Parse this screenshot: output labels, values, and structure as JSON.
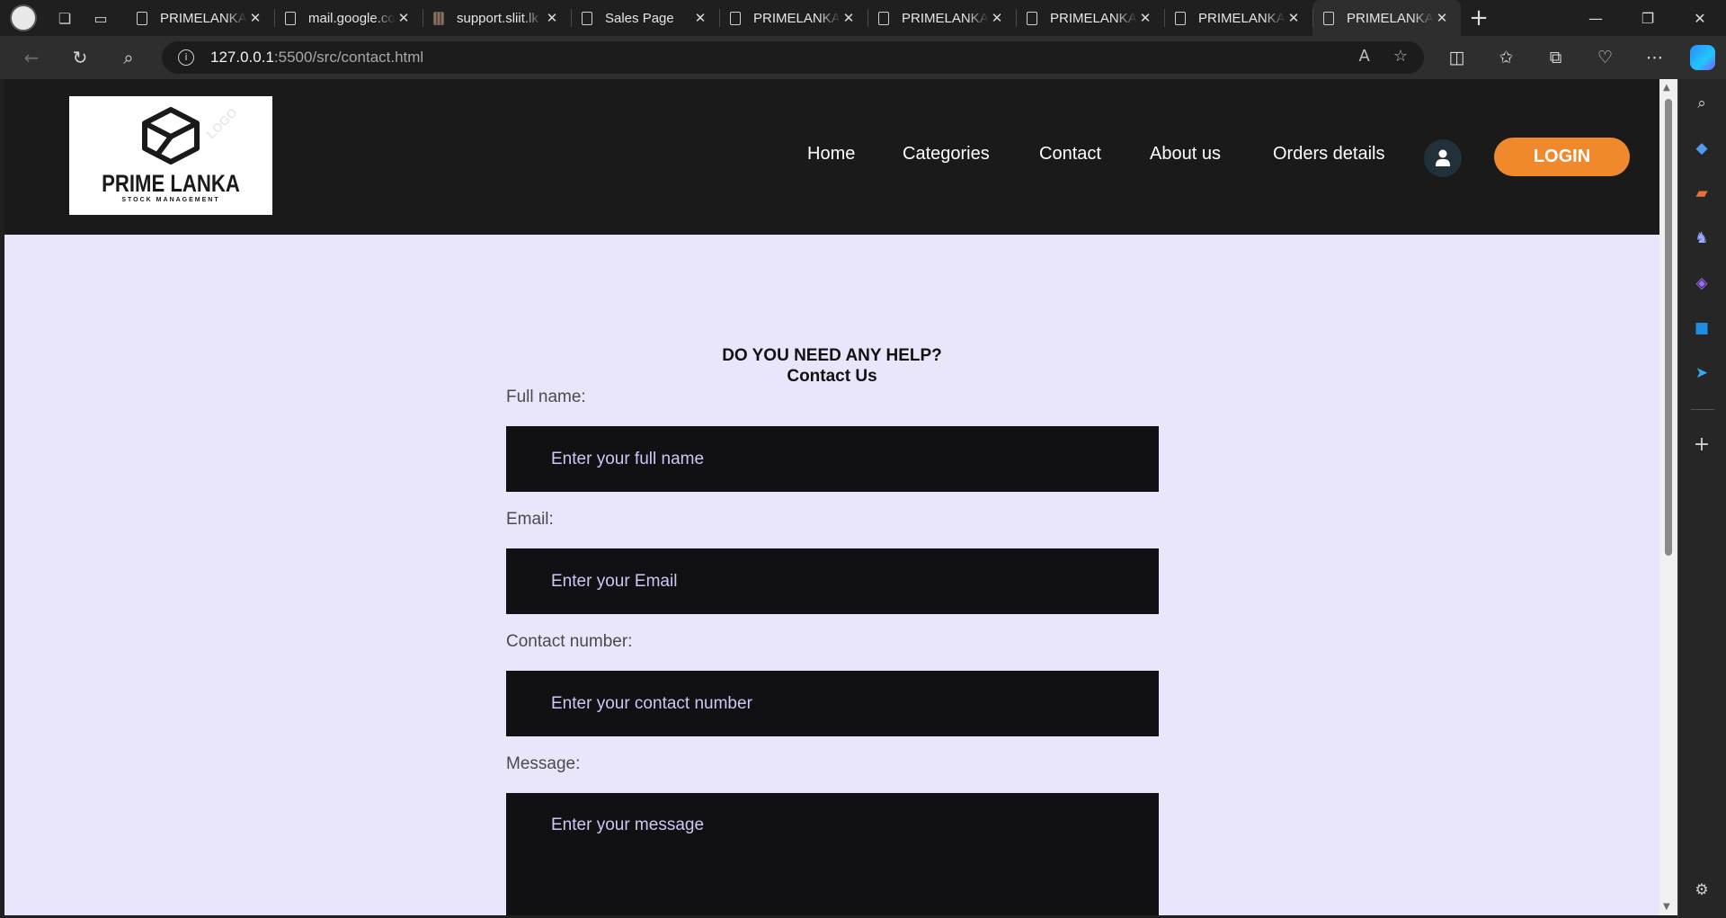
{
  "browser": {
    "tabs": [
      {
        "title": "PRIMELANKA",
        "active": false
      },
      {
        "title": "mail.google.com",
        "active": false
      },
      {
        "title": "support.sliit.lk",
        "active": false
      },
      {
        "title": "Sales Page",
        "active": false
      },
      {
        "title": "PRIMELANKA",
        "active": false
      },
      {
        "title": "PRIMELANKA",
        "active": false
      },
      {
        "title": "PRIMELANKA",
        "active": false
      },
      {
        "title": "PRIMELANKA",
        "active": false
      },
      {
        "title": "PRIMELANKA",
        "active": true
      }
    ],
    "url_host": "127.0.0.1",
    "url_path": ":5500/src/contact.html"
  },
  "site": {
    "logo": {
      "brand": "PRIME LANKA",
      "subtitle": "STOCK MANAGEMENT",
      "watermark": "LOGO"
    },
    "nav": [
      "Home",
      "Categories",
      "Contact",
      "About us",
      "Orders details"
    ],
    "login_label": "LOGIN"
  },
  "contact": {
    "heading_line1": "DO YOU NEED ANY HELP?",
    "heading_line2": "Contact Us",
    "fields": [
      {
        "label": "Full name:",
        "placeholder": "Enter your full name"
      },
      {
        "label": "Email:",
        "placeholder": "Enter your Email"
      },
      {
        "label": "Contact number:",
        "placeholder": "Enter your contact number"
      },
      {
        "label": "Message:",
        "placeholder": "Enter your message"
      }
    ]
  },
  "colors": {
    "header_bg": "#1a1a1a",
    "page_bg": "#e9e6fc",
    "login_bg": "#f0892b",
    "input_bg": "#111113",
    "placeholder": "#cfc6f5"
  }
}
